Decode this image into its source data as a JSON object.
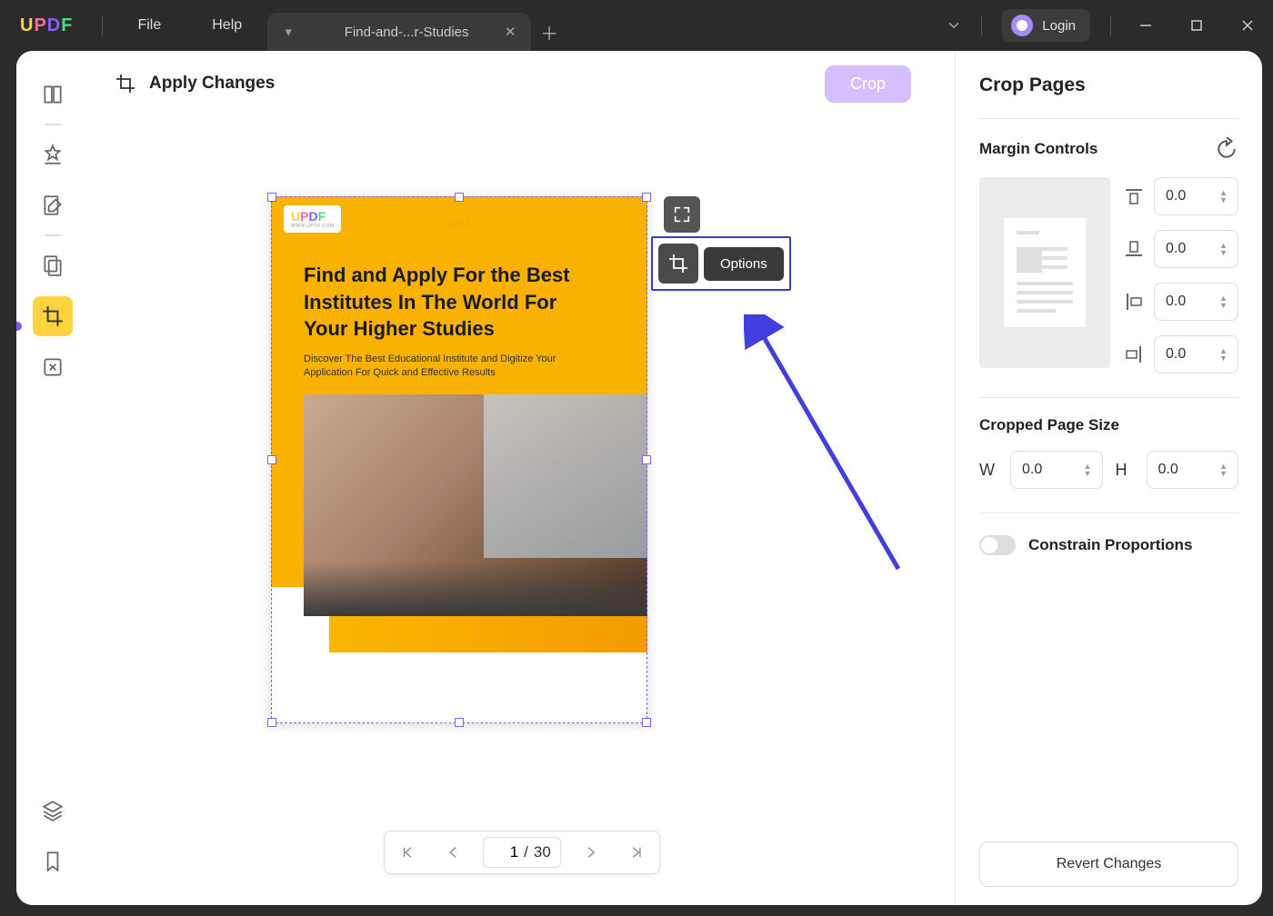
{
  "titlebar": {
    "file": "File",
    "help": "Help",
    "tab_title": "Find-and-...r-Studies",
    "login": "Login"
  },
  "toolbar": {
    "apply_changes": "Apply Changes",
    "crop": "Crop"
  },
  "document": {
    "small_brand": "UPDF",
    "heading": "Find and Apply For the Best Institutes In The World For Your Higher Studies",
    "subheading": "Discover The Best Educational Institute and Digitize Your Application For Quick and Effective Results"
  },
  "float": {
    "options": "Options"
  },
  "pagenav": {
    "current": "1",
    "sep": "/",
    "total": "30"
  },
  "rightpanel": {
    "title": "Crop Pages",
    "margin_controls": "Margin Controls",
    "margins": {
      "top": "0.0",
      "bottom": "0.0",
      "left": "0.0",
      "right": "0.0"
    },
    "cropped_size_label": "Cropped Page Size",
    "width_label": "W",
    "height_label": "H",
    "width": "0.0",
    "height": "0.0",
    "constrain": "Constrain Proportions",
    "revert": "Revert Changes"
  }
}
